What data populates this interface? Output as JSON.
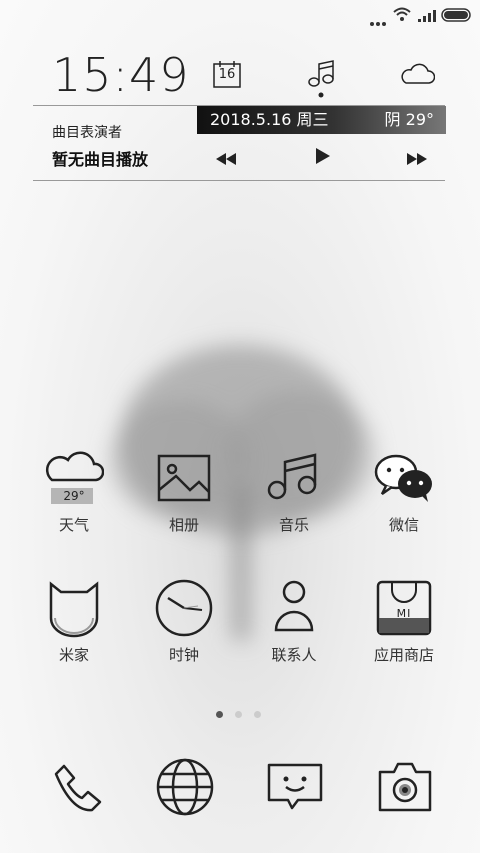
{
  "status_bar": {
    "icons": [
      "more-dots-icon",
      "wifi-icon",
      "signal-icon",
      "battery-icon"
    ]
  },
  "widget": {
    "time": "15:49",
    "calendar_day": "16",
    "date_text": "2018.5.16 周三",
    "weather_text": "阴 29°",
    "music": {
      "artist_placeholder": "曲目表演者",
      "title_placeholder": "暂无曲目播放",
      "controls": [
        "previous-icon",
        "play-icon",
        "next-icon"
      ]
    },
    "top_icons": [
      "calendar-icon",
      "music-note-icon",
      "cloud-icon"
    ]
  },
  "apps": [
    {
      "label": "天气",
      "icon": "weather-cloud-icon",
      "badge": "29°"
    },
    {
      "label": "相册",
      "icon": "gallery-icon"
    },
    {
      "label": "音乐",
      "icon": "music-icon"
    },
    {
      "label": "微信",
      "icon": "wechat-icon"
    },
    {
      "label": "米家",
      "icon": "mijia-icon"
    },
    {
      "label": "时钟",
      "icon": "clock-icon"
    },
    {
      "label": "联系人",
      "icon": "contacts-icon"
    },
    {
      "label": "应用商店",
      "icon": "app-store-icon",
      "badge": "MI"
    }
  ],
  "page_indicator": {
    "count": 3,
    "active": 1
  },
  "dock": [
    "phone-icon",
    "browser-icon",
    "messages-icon",
    "camera-icon"
  ],
  "colors": {
    "accent": "#222222",
    "date_bar_start": "#111111",
    "date_bar_end": "#777777"
  }
}
